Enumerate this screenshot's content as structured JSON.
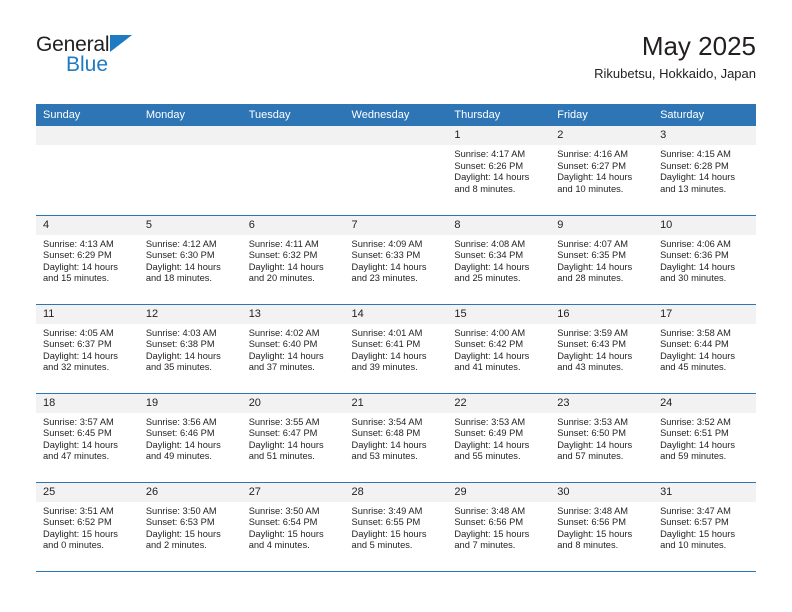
{
  "brand": {
    "name_top": "General",
    "name_bottom": "Blue",
    "triangle_color": "#1f7bc1"
  },
  "header": {
    "title": "May 2025",
    "subtitle": "Rikubetsu, Hokkaido, Japan"
  },
  "theme": {
    "header_blue": "#2e75b6",
    "daynum_gray": "#f2f2f2",
    "text": "#231f20"
  },
  "weekdays": [
    "Sunday",
    "Monday",
    "Tuesday",
    "Wednesday",
    "Thursday",
    "Friday",
    "Saturday"
  ],
  "weeks": [
    [
      {
        "day": "",
        "lines": []
      },
      {
        "day": "",
        "lines": []
      },
      {
        "day": "",
        "lines": []
      },
      {
        "day": "",
        "lines": []
      },
      {
        "day": "1",
        "lines": [
          "Sunrise: 4:17 AM",
          "Sunset: 6:26 PM",
          "Daylight: 14 hours",
          "and 8 minutes."
        ]
      },
      {
        "day": "2",
        "lines": [
          "Sunrise: 4:16 AM",
          "Sunset: 6:27 PM",
          "Daylight: 14 hours",
          "and 10 minutes."
        ]
      },
      {
        "day": "3",
        "lines": [
          "Sunrise: 4:15 AM",
          "Sunset: 6:28 PM",
          "Daylight: 14 hours",
          "and 13 minutes."
        ]
      }
    ],
    [
      {
        "day": "4",
        "lines": [
          "Sunrise: 4:13 AM",
          "Sunset: 6:29 PM",
          "Daylight: 14 hours",
          "and 15 minutes."
        ]
      },
      {
        "day": "5",
        "lines": [
          "Sunrise: 4:12 AM",
          "Sunset: 6:30 PM",
          "Daylight: 14 hours",
          "and 18 minutes."
        ]
      },
      {
        "day": "6",
        "lines": [
          "Sunrise: 4:11 AM",
          "Sunset: 6:32 PM",
          "Daylight: 14 hours",
          "and 20 minutes."
        ]
      },
      {
        "day": "7",
        "lines": [
          "Sunrise: 4:09 AM",
          "Sunset: 6:33 PM",
          "Daylight: 14 hours",
          "and 23 minutes."
        ]
      },
      {
        "day": "8",
        "lines": [
          "Sunrise: 4:08 AM",
          "Sunset: 6:34 PM",
          "Daylight: 14 hours",
          "and 25 minutes."
        ]
      },
      {
        "day": "9",
        "lines": [
          "Sunrise: 4:07 AM",
          "Sunset: 6:35 PM",
          "Daylight: 14 hours",
          "and 28 minutes."
        ]
      },
      {
        "day": "10",
        "lines": [
          "Sunrise: 4:06 AM",
          "Sunset: 6:36 PM",
          "Daylight: 14 hours",
          "and 30 minutes."
        ]
      }
    ],
    [
      {
        "day": "11",
        "lines": [
          "Sunrise: 4:05 AM",
          "Sunset: 6:37 PM",
          "Daylight: 14 hours",
          "and 32 minutes."
        ]
      },
      {
        "day": "12",
        "lines": [
          "Sunrise: 4:03 AM",
          "Sunset: 6:38 PM",
          "Daylight: 14 hours",
          "and 35 minutes."
        ]
      },
      {
        "day": "13",
        "lines": [
          "Sunrise: 4:02 AM",
          "Sunset: 6:40 PM",
          "Daylight: 14 hours",
          "and 37 minutes."
        ]
      },
      {
        "day": "14",
        "lines": [
          "Sunrise: 4:01 AM",
          "Sunset: 6:41 PM",
          "Daylight: 14 hours",
          "and 39 minutes."
        ]
      },
      {
        "day": "15",
        "lines": [
          "Sunrise: 4:00 AM",
          "Sunset: 6:42 PM",
          "Daylight: 14 hours",
          "and 41 minutes."
        ]
      },
      {
        "day": "16",
        "lines": [
          "Sunrise: 3:59 AM",
          "Sunset: 6:43 PM",
          "Daylight: 14 hours",
          "and 43 minutes."
        ]
      },
      {
        "day": "17",
        "lines": [
          "Sunrise: 3:58 AM",
          "Sunset: 6:44 PM",
          "Daylight: 14 hours",
          "and 45 minutes."
        ]
      }
    ],
    [
      {
        "day": "18",
        "lines": [
          "Sunrise: 3:57 AM",
          "Sunset: 6:45 PM",
          "Daylight: 14 hours",
          "and 47 minutes."
        ]
      },
      {
        "day": "19",
        "lines": [
          "Sunrise: 3:56 AM",
          "Sunset: 6:46 PM",
          "Daylight: 14 hours",
          "and 49 minutes."
        ]
      },
      {
        "day": "20",
        "lines": [
          "Sunrise: 3:55 AM",
          "Sunset: 6:47 PM",
          "Daylight: 14 hours",
          "and 51 minutes."
        ]
      },
      {
        "day": "21",
        "lines": [
          "Sunrise: 3:54 AM",
          "Sunset: 6:48 PM",
          "Daylight: 14 hours",
          "and 53 minutes."
        ]
      },
      {
        "day": "22",
        "lines": [
          "Sunrise: 3:53 AM",
          "Sunset: 6:49 PM",
          "Daylight: 14 hours",
          "and 55 minutes."
        ]
      },
      {
        "day": "23",
        "lines": [
          "Sunrise: 3:53 AM",
          "Sunset: 6:50 PM",
          "Daylight: 14 hours",
          "and 57 minutes."
        ]
      },
      {
        "day": "24",
        "lines": [
          "Sunrise: 3:52 AM",
          "Sunset: 6:51 PM",
          "Daylight: 14 hours",
          "and 59 minutes."
        ]
      }
    ],
    [
      {
        "day": "25",
        "lines": [
          "Sunrise: 3:51 AM",
          "Sunset: 6:52 PM",
          "Daylight: 15 hours",
          "and 0 minutes."
        ]
      },
      {
        "day": "26",
        "lines": [
          "Sunrise: 3:50 AM",
          "Sunset: 6:53 PM",
          "Daylight: 15 hours",
          "and 2 minutes."
        ]
      },
      {
        "day": "27",
        "lines": [
          "Sunrise: 3:50 AM",
          "Sunset: 6:54 PM",
          "Daylight: 15 hours",
          "and 4 minutes."
        ]
      },
      {
        "day": "28",
        "lines": [
          "Sunrise: 3:49 AM",
          "Sunset: 6:55 PM",
          "Daylight: 15 hours",
          "and 5 minutes."
        ]
      },
      {
        "day": "29",
        "lines": [
          "Sunrise: 3:48 AM",
          "Sunset: 6:56 PM",
          "Daylight: 15 hours",
          "and 7 minutes."
        ]
      },
      {
        "day": "30",
        "lines": [
          "Sunrise: 3:48 AM",
          "Sunset: 6:56 PM",
          "Daylight: 15 hours",
          "and 8 minutes."
        ]
      },
      {
        "day": "31",
        "lines": [
          "Sunrise: 3:47 AM",
          "Sunset: 6:57 PM",
          "Daylight: 15 hours",
          "and 10 minutes."
        ]
      }
    ]
  ]
}
